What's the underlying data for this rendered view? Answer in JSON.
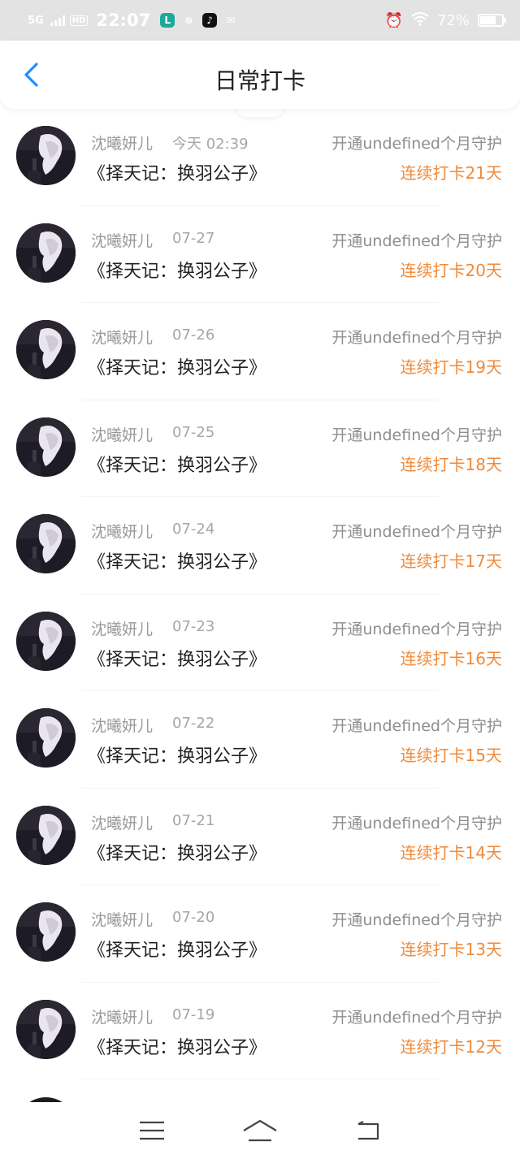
{
  "status_bar": {
    "network": "5G",
    "hd": "HD",
    "time": "22:07",
    "battery": "72%",
    "battery_level": 0.72,
    "app_icons": [
      {
        "name": "vpn-app-icon",
        "glyph": "L",
        "color": "#1aa99a"
      },
      {
        "name": "netease-music-icon",
        "glyph": "⊚",
        "color": "transparent"
      },
      {
        "name": "tiktok-icon",
        "glyph": "♪",
        "color": "#111111"
      },
      {
        "name": "message-app-icon",
        "glyph": "✉",
        "color": "transparent"
      }
    ]
  },
  "header": {
    "title": "日常打卡",
    "back_icon": "chevron-left-icon",
    "accent_color": "#1e90ff"
  },
  "colors": {
    "streak": "#f08a3a",
    "secondary_text": "#9a9a9a"
  },
  "checkins": [
    {
      "name": "沈曦妍儿",
      "date": "今天 02:39",
      "guard": "开通undefined个月守护",
      "book": "《择天记：换羽公子》",
      "streak": "连续打卡21天"
    },
    {
      "name": "沈曦妍儿",
      "date": "07-27",
      "guard": "开通undefined个月守护",
      "book": "《择天记：换羽公子》",
      "streak": "连续打卡20天"
    },
    {
      "name": "沈曦妍儿",
      "date": "07-26",
      "guard": "开通undefined个月守护",
      "book": "《择天记：换羽公子》",
      "streak": "连续打卡19天"
    },
    {
      "name": "沈曦妍儿",
      "date": "07-25",
      "guard": "开通undefined个月守护",
      "book": "《择天记：换羽公子》",
      "streak": "连续打卡18天"
    },
    {
      "name": "沈曦妍儿",
      "date": "07-24",
      "guard": "开通undefined个月守护",
      "book": "《择天记：换羽公子》",
      "streak": "连续打卡17天"
    },
    {
      "name": "沈曦妍儿",
      "date": "07-23",
      "guard": "开通undefined个月守护",
      "book": "《择天记：换羽公子》",
      "streak": "连续打卡16天"
    },
    {
      "name": "沈曦妍儿",
      "date": "07-22",
      "guard": "开通undefined个月守护",
      "book": "《择天记：换羽公子》",
      "streak": "连续打卡15天"
    },
    {
      "name": "沈曦妍儿",
      "date": "07-21",
      "guard": "开通undefined个月守护",
      "book": "《择天记：换羽公子》",
      "streak": "连续打卡14天"
    },
    {
      "name": "沈曦妍儿",
      "date": "07-20",
      "guard": "开通undefined个月守护",
      "book": "《择天记：换羽公子》",
      "streak": "连续打卡13天"
    },
    {
      "name": "沈曦妍儿",
      "date": "07-19",
      "guard": "开通undefined个月守护",
      "book": "《择天记：换羽公子》",
      "streak": "连续打卡12天"
    }
  ],
  "bottom_nav": [
    {
      "name": "menu-icon"
    },
    {
      "name": "home-icon"
    },
    {
      "name": "back-icon"
    }
  ]
}
